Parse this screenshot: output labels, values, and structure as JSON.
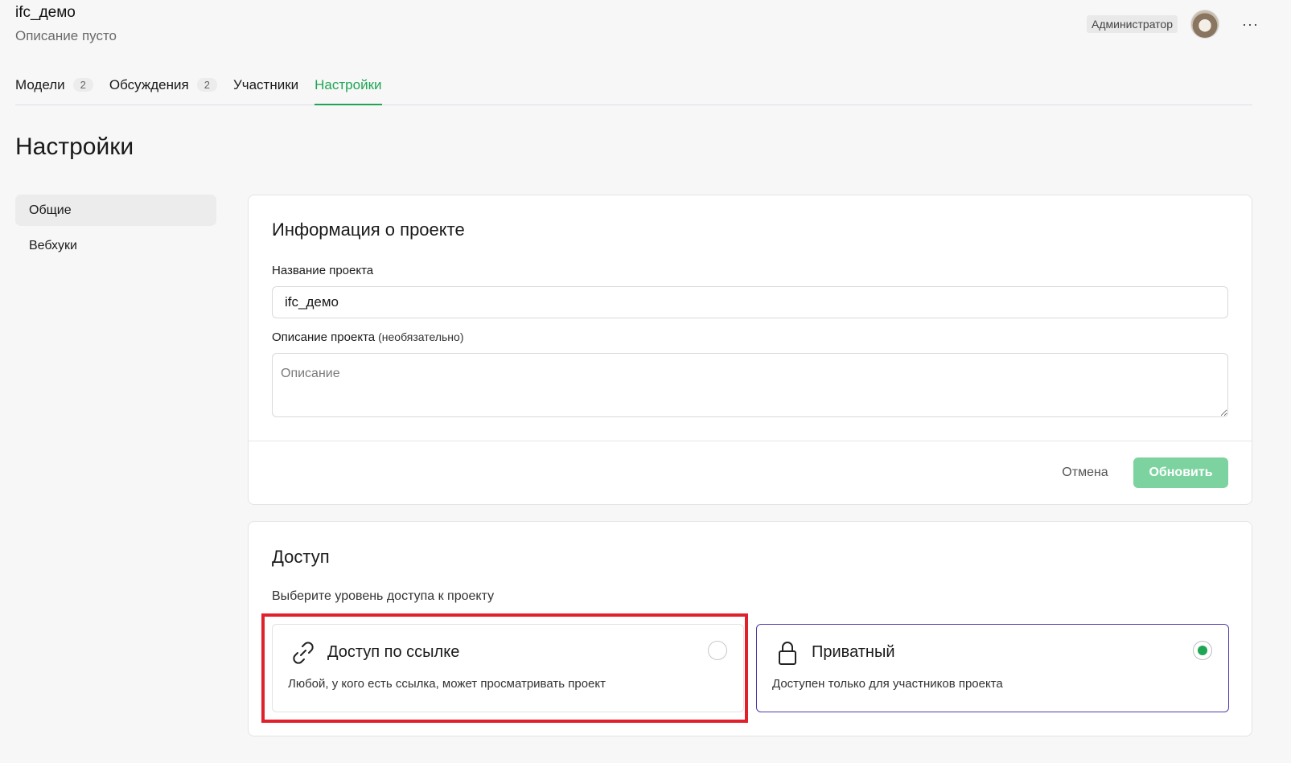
{
  "project": {
    "name": "ifc_демо",
    "description": "Описание пусто"
  },
  "user": {
    "role": "Администратор",
    "more": "···"
  },
  "tabs": [
    {
      "label": "Модели",
      "count": "2"
    },
    {
      "label": "Обсуждения",
      "count": "2"
    },
    {
      "label": "Участники"
    },
    {
      "label": "Настройки",
      "active": true
    }
  ],
  "page_title": "Настройки",
  "sidenav": [
    {
      "label": "Общие",
      "active": true
    },
    {
      "label": "Вебхуки"
    }
  ],
  "info_card": {
    "title": "Информация о проекте",
    "name_label": "Название проекта",
    "name_value": "ifc_демо",
    "desc_label": "Описание проекта",
    "desc_optional": "(необязательно)",
    "desc_placeholder": "Описание",
    "cancel_label": "Отмена",
    "update_label": "Обновить"
  },
  "access_card": {
    "title": "Доступ",
    "subtitle": "Выберите уровень доступа к проекту",
    "options": [
      {
        "title": "Доступ по ссылке",
        "description": "Любой, у кого есть ссылка, может просматривать проект",
        "icon": "link-icon",
        "selected": false
      },
      {
        "title": "Приватный",
        "description": "Доступен только для участников проекта",
        "icon": "lock-icon",
        "selected": true
      }
    ]
  },
  "colors": {
    "accent": "#1ea654",
    "selected_border": "#4b3dab",
    "highlight": "#e0212b",
    "update_button": "#7dd3a0"
  }
}
